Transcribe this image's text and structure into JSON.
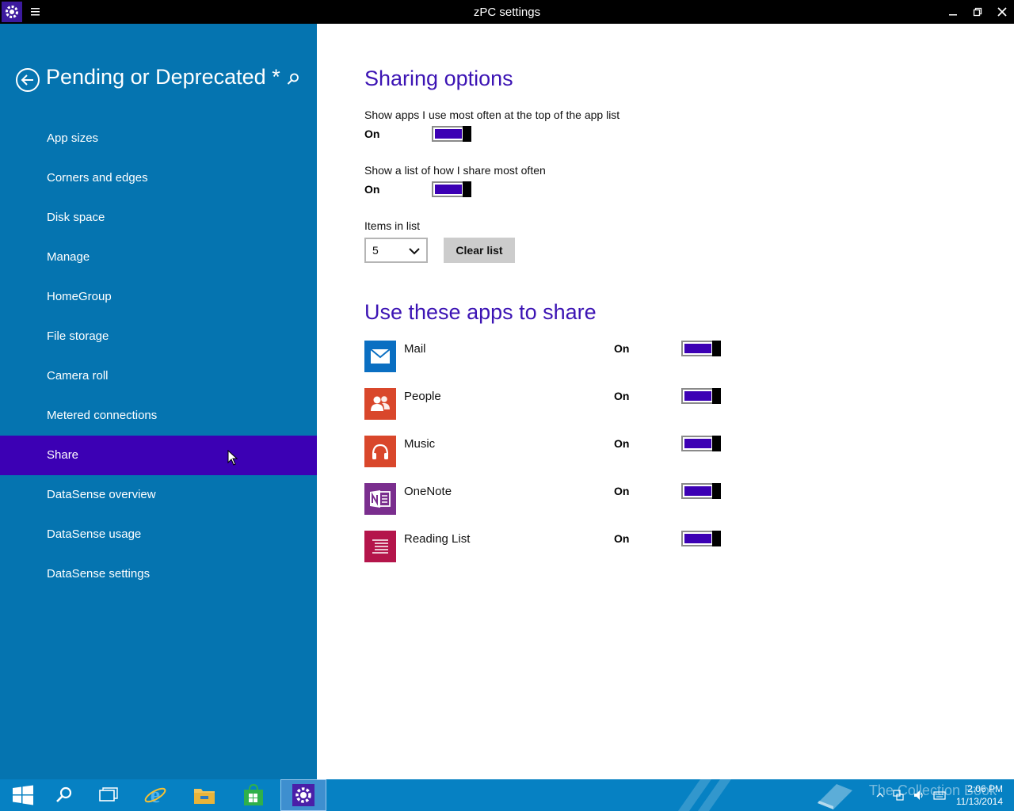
{
  "window": {
    "title": "zPC settings"
  },
  "sidebar": {
    "title": "Pending or Deprecated *",
    "items": [
      {
        "label": "App sizes"
      },
      {
        "label": "Corners and edges"
      },
      {
        "label": "Disk space"
      },
      {
        "label": "Manage"
      },
      {
        "label": "HomeGroup"
      },
      {
        "label": "File storage"
      },
      {
        "label": "Camera roll"
      },
      {
        "label": "Metered connections"
      },
      {
        "label": "Share",
        "selected": true
      },
      {
        "label": "DataSense overview"
      },
      {
        "label": "DataSense usage"
      },
      {
        "label": "DataSense settings"
      }
    ]
  },
  "sharing": {
    "heading": "Sharing options",
    "option1": {
      "label": "Show apps I use most often at the top of the app list",
      "state": "On"
    },
    "option2": {
      "label": "Show a list of how I share most often",
      "state": "On"
    },
    "items_label": "Items in list",
    "items_value": "5",
    "clear_label": "Clear list"
  },
  "apps": {
    "heading": "Use these apps to share",
    "list": [
      {
        "name": "Mail",
        "state": "On",
        "color": "#0a6fc2"
      },
      {
        "name": "People",
        "state": "On",
        "color": "#d9472b"
      },
      {
        "name": "Music",
        "state": "On",
        "color": "#d9472b"
      },
      {
        "name": "OneNote",
        "state": "On",
        "color": "#7a2e8e"
      },
      {
        "name": "Reading List",
        "state": "On",
        "color": "#b4154b"
      }
    ]
  },
  "taskbar": {
    "time": "2:06 PM",
    "date": "11/13/2014",
    "watermark": "The Collection Book"
  },
  "colors": {
    "accent": "#3c00b4",
    "sidebar": "#0574b0",
    "taskbar": "#0681c3"
  }
}
